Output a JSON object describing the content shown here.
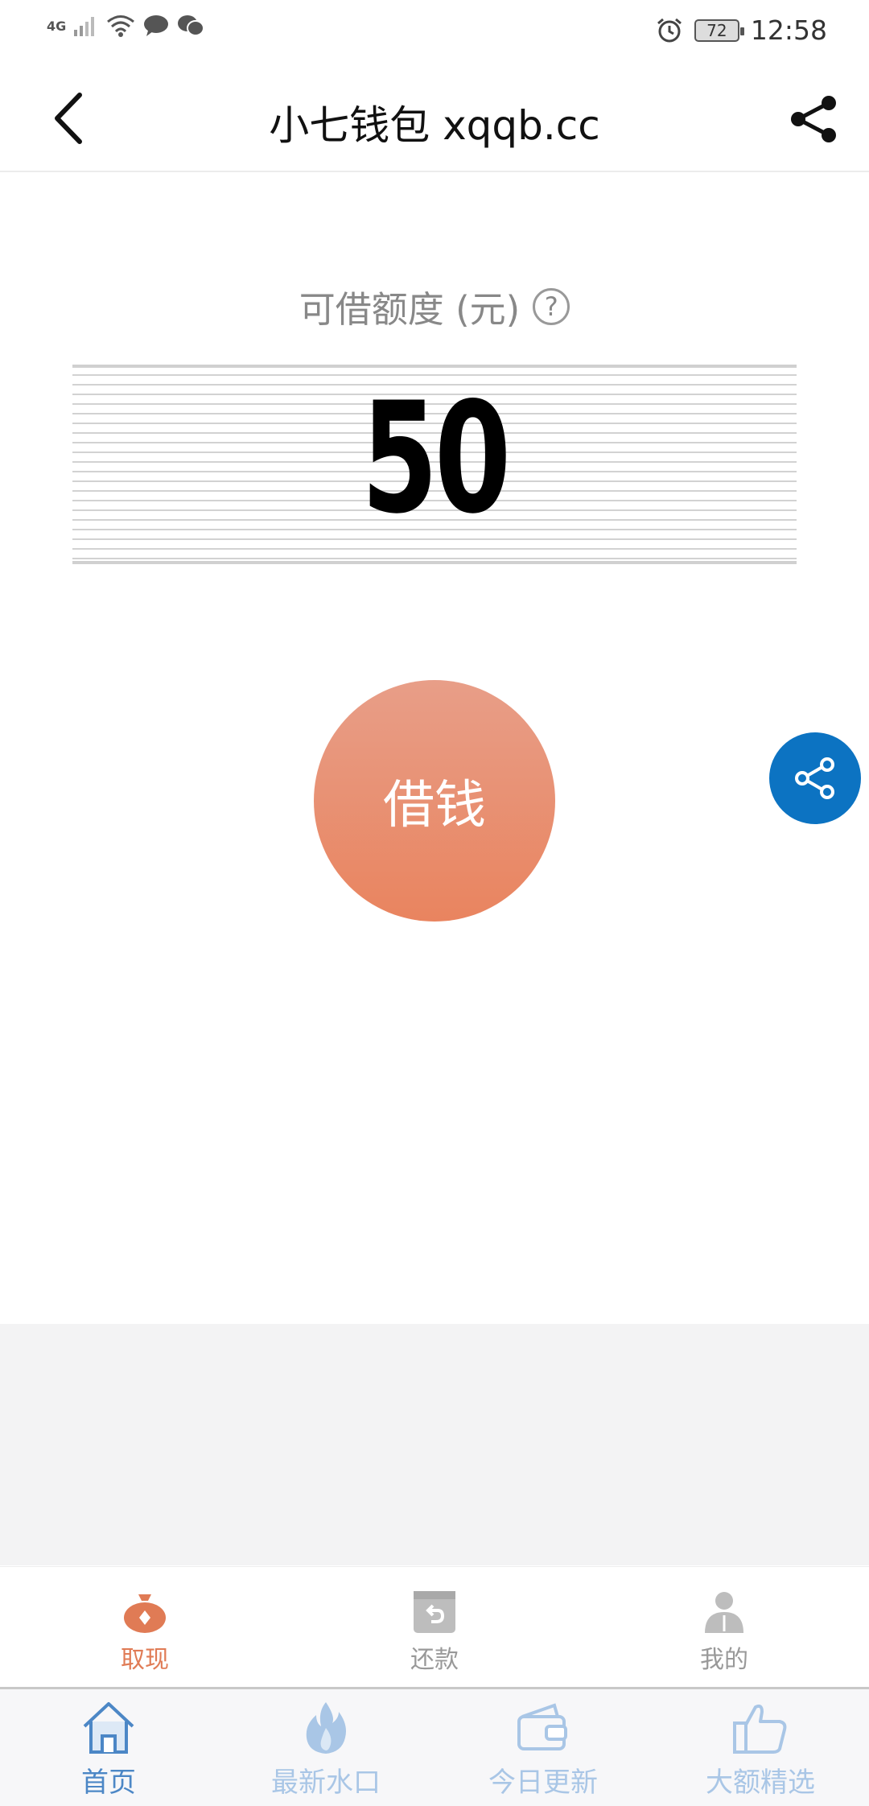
{
  "status_bar": {
    "network": "4G",
    "battery": "72",
    "time": "12:58"
  },
  "header": {
    "title": "小七钱包 xqqb.cc"
  },
  "credit": {
    "label": "可借额度 (元)",
    "help_symbol": "?",
    "amount": "50"
  },
  "borrow": {
    "label": "借钱",
    "color_top": "#e89e88",
    "color_bottom": "#e9845f"
  },
  "inner_tabs": [
    {
      "label": "取现",
      "icon": "money-bag-icon",
      "active": true
    },
    {
      "label": "还款",
      "icon": "repay-icon",
      "active": false
    },
    {
      "label": "我的",
      "icon": "user-icon",
      "active": false
    }
  ],
  "bottom_nav": [
    {
      "label": "首页",
      "icon": "home-icon",
      "active": true
    },
    {
      "label": "最新水口",
      "icon": "flame-icon",
      "active": false
    },
    {
      "label": "今日更新",
      "icon": "wallet-icon",
      "active": false
    },
    {
      "label": "大额精选",
      "icon": "thumbs-up-icon",
      "active": false
    }
  ],
  "colors": {
    "accent": "#e07b55",
    "float_share": "#0c73c2",
    "nav_active": "#4c87c6",
    "nav_inactive": "#a9c6e6"
  }
}
